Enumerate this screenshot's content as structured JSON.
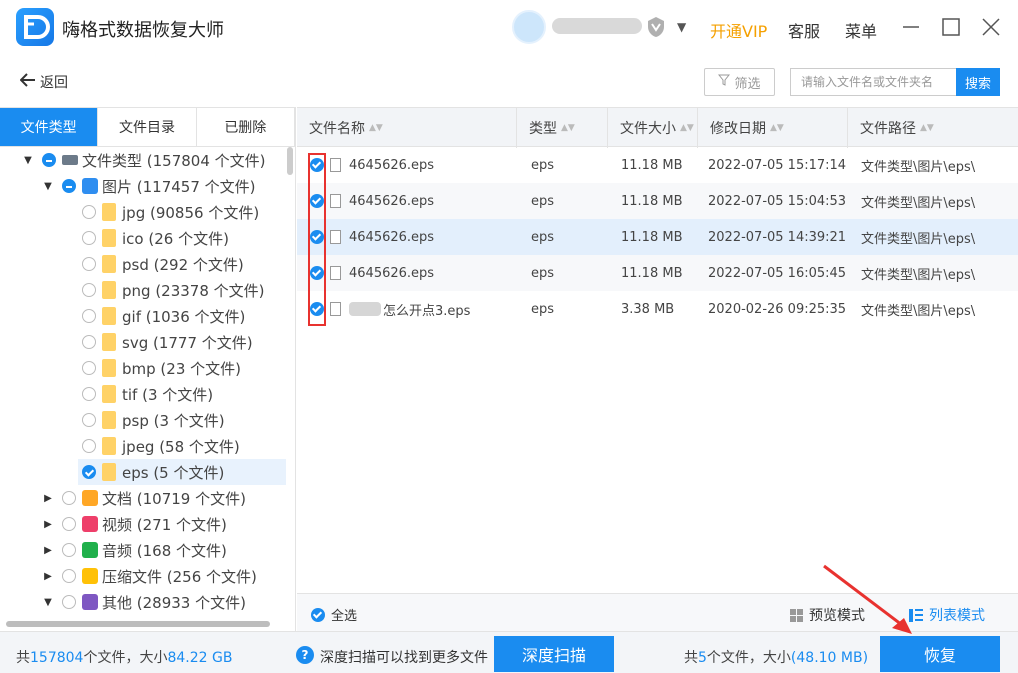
{
  "app": {
    "title": "嗨格式数据恢复大师"
  },
  "header": {
    "vip": "开通VIP",
    "service": "客服",
    "menu": "菜单"
  },
  "toolbar": {
    "back": "返回",
    "filter": "筛选",
    "search_placeholder": "请输入文件名或文件夹名",
    "search": "搜索"
  },
  "left_tabs": [
    "文件类型",
    "文件目录",
    "已删除"
  ],
  "tree": [
    {
      "label": "文件类型 (157804 个文件)"
    },
    {
      "label": "图片 (117457 个文件)"
    },
    {
      "label": "jpg (90856 个文件)"
    },
    {
      "label": "ico (26 个文件)"
    },
    {
      "label": "psd (292 个文件)"
    },
    {
      "label": "png (23378 个文件)"
    },
    {
      "label": "gif (1036 个文件)"
    },
    {
      "label": "svg (1777 个文件)"
    },
    {
      "label": "bmp (23 个文件)"
    },
    {
      "label": "tif (3 个文件)"
    },
    {
      "label": "psp (3 个文件)"
    },
    {
      "label": "jpeg (58 个文件)"
    },
    {
      "label": "eps (5 个文件)"
    },
    {
      "label": "文档 (10719 个文件)"
    },
    {
      "label": "视频 (271 个文件)"
    },
    {
      "label": "音频 (168 个文件)"
    },
    {
      "label": "压缩文件 (256 个文件)"
    },
    {
      "label": "其他 (28933 个文件)"
    }
  ],
  "table": {
    "columns": [
      "文件名称",
      "类型",
      "文件大小",
      "修改日期",
      "文件路径"
    ],
    "rows": [
      {
        "name": "4645626.eps",
        "type": "eps",
        "size": "11.18 MB",
        "date": "2022-07-05 15:17:14",
        "path": "文件类型\\图片\\eps\\"
      },
      {
        "name": "4645626.eps",
        "type": "eps",
        "size": "11.18 MB",
        "date": "2022-07-05 15:04:53",
        "path": "文件类型\\图片\\eps\\"
      },
      {
        "name": "4645626.eps",
        "type": "eps",
        "size": "11.18 MB",
        "date": "2022-07-05 14:39:21",
        "path": "文件类型\\图片\\eps\\"
      },
      {
        "name": "4645626.eps",
        "type": "eps",
        "size": "11.18 MB",
        "date": "2022-07-05 16:05:45",
        "path": "文件类型\\图片\\eps\\"
      },
      {
        "name": "怎么开点3.eps",
        "type": "eps",
        "size": "3.38 MB",
        "date": "2020-02-26 09:25:35",
        "path": "文件类型\\图片\\eps\\"
      }
    ]
  },
  "footer": {
    "select_all": "全选",
    "preview_mode": "预览模式",
    "list_mode": "列表模式"
  },
  "status": {
    "total_prefix": "共",
    "total_count": "157804",
    "total_mid": "个文件，大小",
    "total_size": "84.22 GB",
    "hint": "深度扫描可以找到更多文件",
    "deep_scan": "深度扫描",
    "sel_prefix": "共",
    "sel_count": "5",
    "sel_mid": "个文件，大小",
    "sel_size": "(48.10 MB)",
    "recover": "恢复"
  },
  "colors": {
    "accent": "#1a8cf0",
    "vip": "#f5a000",
    "annotation": "#e8322f"
  },
  "icons": [
    "app-logo",
    "back-arrow-icon",
    "filter-icon",
    "shield-badge-icon",
    "minimize-icon",
    "maximize-icon",
    "close-icon",
    "help-icon"
  ]
}
